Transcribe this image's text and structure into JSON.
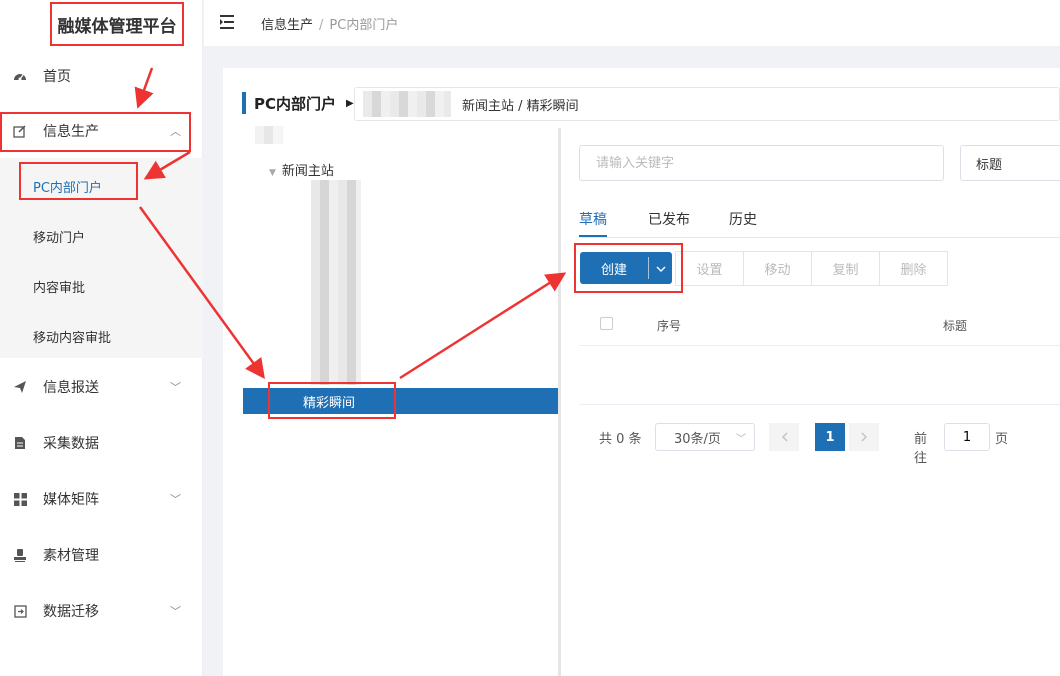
{
  "app": {
    "title": "融媒体管理平台"
  },
  "sidebar": {
    "items": [
      {
        "label": "首页",
        "icon": "dashboard-icon"
      },
      {
        "label": "信息生产",
        "icon": "edit-icon"
      },
      {
        "label": "信息报送",
        "icon": "send-icon"
      },
      {
        "label": "采集数据",
        "icon": "document-icon"
      },
      {
        "label": "媒体矩阵",
        "icon": "grid-icon"
      },
      {
        "label": "素材管理",
        "icon": "stamp-icon"
      },
      {
        "label": "数据迁移",
        "icon": "migrate-icon"
      }
    ],
    "submenu": [
      "PC内部门户",
      "移动门户",
      "内容审批",
      "移动内容审批"
    ]
  },
  "header": {
    "breadcrumb": [
      "信息生产",
      "PC内部门户"
    ],
    "separator": "/"
  },
  "panel": {
    "title": "PC内部门户",
    "path": "新闻主站 / 精彩瞬间"
  },
  "tree": {
    "root": "新闻主站",
    "selected": "精彩瞬间"
  },
  "search": {
    "placeholder": "请输入关键字",
    "field": "标题"
  },
  "tabs": [
    "草稿",
    "已发布",
    "历史"
  ],
  "toolbar": {
    "create": "创建",
    "settings": "设置",
    "move": "移动",
    "copy": "复制",
    "delete": "删除"
  },
  "table": {
    "columns": [
      "序号",
      "标题"
    ]
  },
  "pagination": {
    "total": "共 0 条",
    "page_size": "30条/页",
    "current": "1",
    "goto_label": "前往",
    "goto_value": "1",
    "page_suffix": "页"
  },
  "colors": {
    "accent": "#1f6fb5",
    "highlight": "#e33333"
  }
}
